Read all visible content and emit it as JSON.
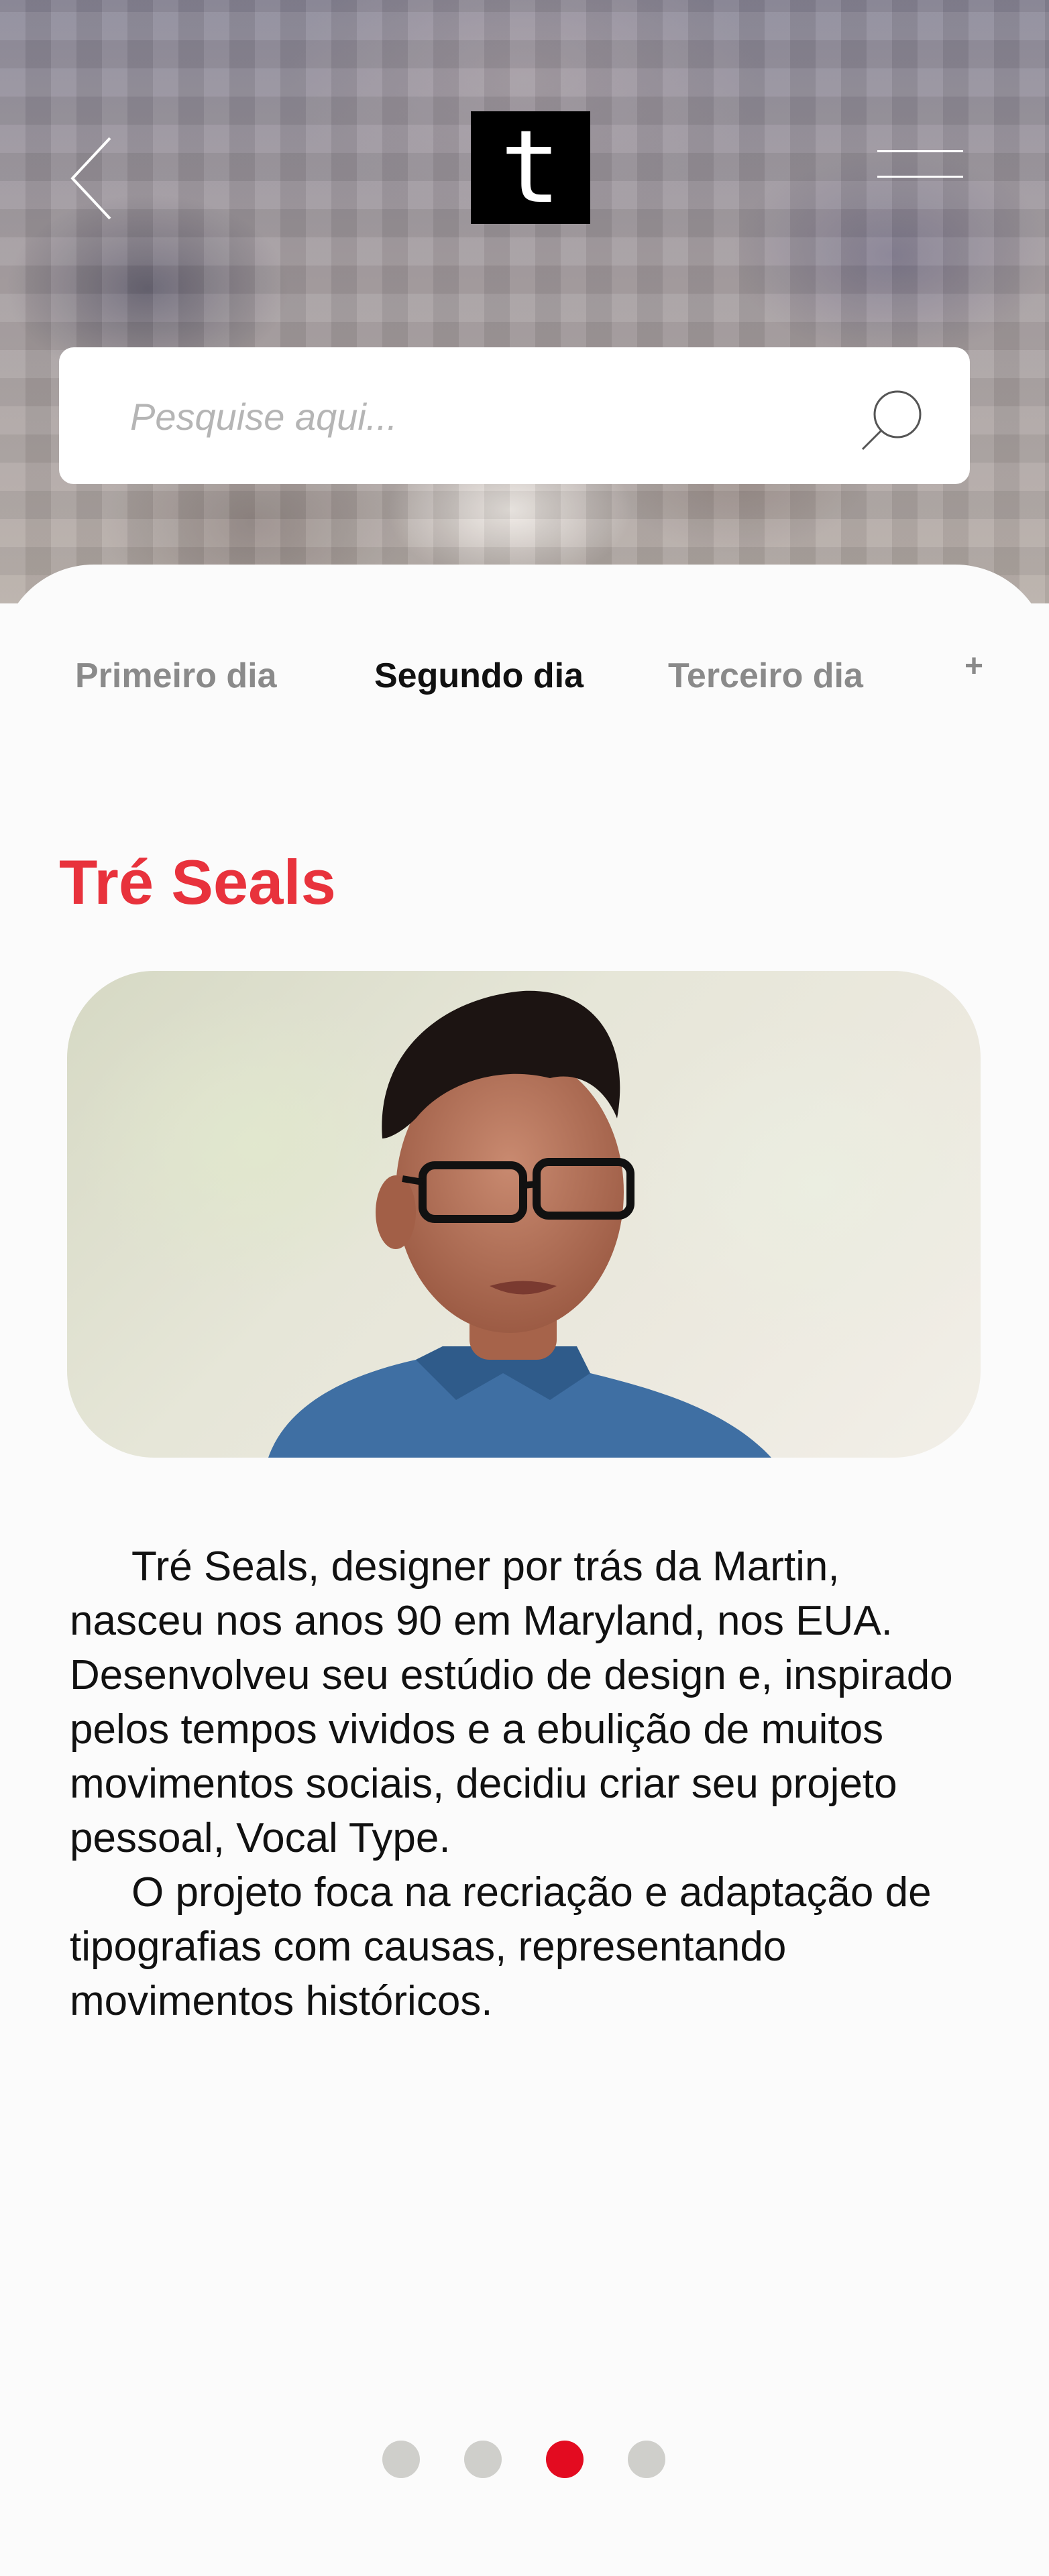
{
  "header": {
    "logo_letter": "t",
    "back_icon": "chevron-left-icon",
    "menu_icon": "hamburger-icon"
  },
  "search": {
    "placeholder": "Pesquise aqui...",
    "icon": "search-icon"
  },
  "tabs": [
    {
      "label": "Primeiro dia",
      "active": false
    },
    {
      "label": "Segundo dia",
      "active": true
    },
    {
      "label": "Terceiro dia",
      "active": false
    }
  ],
  "tab_add_label": "+",
  "article": {
    "title": "Tré Seals",
    "image": "portrait-photo",
    "paragraphs": [
      "Tré Seals, designer por trás da Martin, nasceu nos anos 90 em Maryland, nos EUA. Desenvolveu seu estúdio de design e, inspirado pelos tempos vividos e a ebulição de muitos movimentos sociais, decidiu criar seu projeto pessoal, Vocal Type.",
      "O projeto foca na recriação e adaptação de tipografias com causas, representando movimentos históricos."
    ]
  },
  "pagination": {
    "count": 4,
    "active_index": 2
  },
  "colors": {
    "accent": "#e8323c",
    "pagination_active": "#e30b20",
    "pagination_inactive": "#cfcfcb",
    "tab_active": "#111111",
    "tab_inactive": "#8a8a8a"
  }
}
